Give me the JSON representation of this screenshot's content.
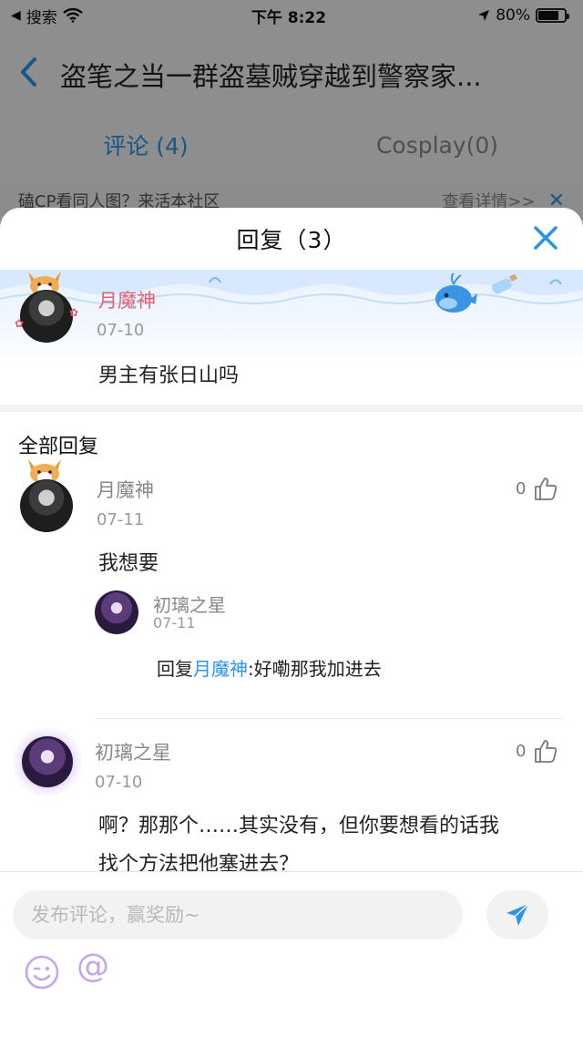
{
  "status_bar": {
    "back_app": "搜索",
    "time": "下午 8:22",
    "battery": "80%",
    "battery_level": 0.8
  },
  "nav": {
    "back_icon": "chevron-left-icon",
    "title": "盗笔之当一群盗墓贼穿越到警察家..."
  },
  "tabs": [
    {
      "label": "评论 (4)",
      "active": true
    },
    {
      "label": "Cosplay(0)",
      "active": false
    }
  ],
  "promo": {
    "text": "磕CP看同人图？来活本社区",
    "link": "查看详情>>"
  },
  "sheet": {
    "title": "回复（3）",
    "close_icon": "close-icon"
  },
  "main_comment": {
    "user": "月魔神",
    "date": "07-10",
    "text": "男主有张日山吗"
  },
  "all_replies_label": "全部回复",
  "replies": [
    {
      "user": "月魔神",
      "date": "07-11",
      "likes": "0",
      "text": "我想要",
      "sub_reply": {
        "user": "初璃之星",
        "date": "07-11",
        "prefix": "回复",
        "mention": "月魔神",
        "text": ":好嘞那我加进去"
      }
    },
    {
      "user": "初璃之星",
      "date": "07-10",
      "likes": "0",
      "text_line1": "啊？那那个……其实没有，但你要想看的话我",
      "text_line2": "找个方法把他塞进去？"
    }
  ],
  "composer": {
    "placeholder": "发布评论，赢奖励~",
    "value": "",
    "send_icon": "send-icon",
    "emoji_icon": "emoji-icon",
    "mention_symbol": "@"
  },
  "colors": {
    "accent": "#2a95e8",
    "main_user_name": "#e2606e",
    "reply_user_name": "#888888"
  }
}
